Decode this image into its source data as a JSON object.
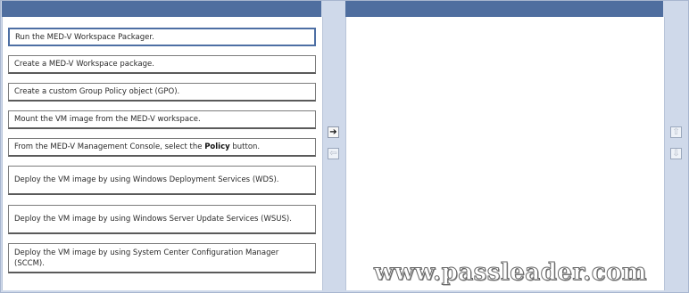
{
  "source_list": {
    "items": [
      {
        "text": "Run the MED-V Workspace Packager.",
        "selected": true
      },
      {
        "text": "Create a MED-V Workspace package."
      },
      {
        "text": "Create a custom Group Policy object (GPO)."
      },
      {
        "text": "Mount the VM image from the MED-V workspace."
      },
      {
        "text_before": "From the MED-V Management Console, select the ",
        "text_bold": "Policy",
        "text_after": " button."
      },
      {
        "text": "Deploy the VM image by using Windows Deployment Services (WDS)."
      },
      {
        "text": "Deploy the VM image by using Windows Server Update Services (WSUS)."
      },
      {
        "text": "Deploy the VM image by using System Center Configuration Manager (SCCM)."
      }
    ]
  },
  "controls": {
    "move_right": "➔",
    "move_left": "⇦",
    "move_up": "⇧",
    "move_down": "⇩"
  },
  "answer_list": {
    "items": []
  },
  "watermark": "www.passleader.com"
}
